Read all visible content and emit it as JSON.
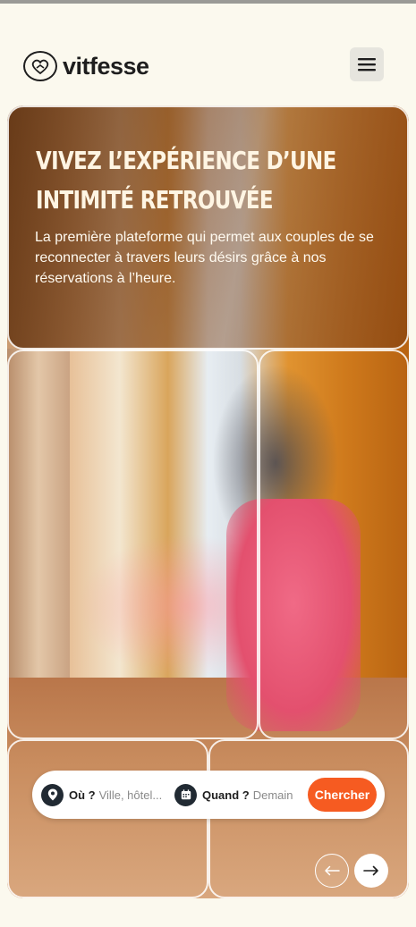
{
  "header": {
    "brand": "vitfesse",
    "logo_icon": "heart-handshake-icon",
    "menu_icon": "hamburger-menu-icon"
  },
  "hero": {
    "title_line1": "VIVEZ L’EXPÉRIENCE D’UNE",
    "title_line2": "INTIMITÉ RETROUVÉE",
    "subtitle": "La première plateforme qui permet aux couples de se reconnecter à travers leurs désirs grâce à nos réservations à l’heure.",
    "image_description_icon": "hero-photo-woman-in-pink-suit"
  },
  "search": {
    "location_label": "Où ?",
    "location_placeholder": "Ville, hôtel...",
    "location_icon": "map-pin-icon",
    "date_label": "Quand ?",
    "date_value": "Demain",
    "date_icon": "calendar-icon",
    "button_label": "Chercher"
  },
  "carousel": {
    "prev_icon": "arrow-left-icon",
    "next_icon": "arrow-right-icon"
  },
  "colors": {
    "background": "#fbf9ee",
    "accent": "#f65b21",
    "dark": "#212a33",
    "title": "#fff5e3"
  }
}
